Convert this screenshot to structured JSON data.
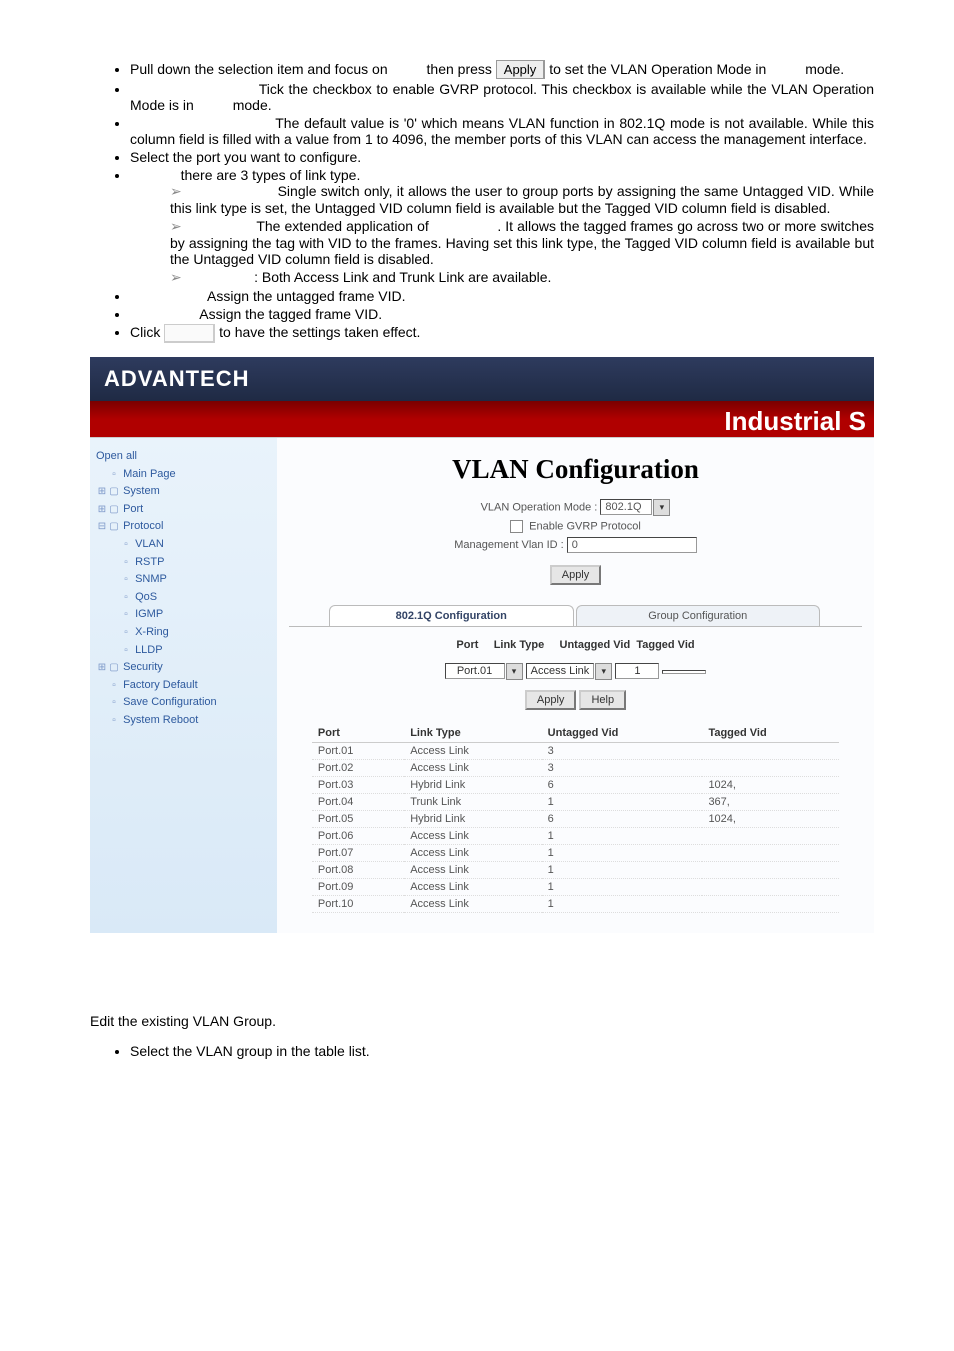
{
  "intro": {
    "li1a": "Pull down the selection item and focus on ",
    "apply_txt": "Apply",
    "li1b": " then press ",
    "li1c": " to set the VLAN Operation Mode in ",
    "li1d": " mode.",
    "li2a": "Tick the checkbox to enable GVRP protocol. This checkbox is available while the VLAN Operation Mode is in ",
    "li2b": " mode.",
    "li3": "The default value is '0' which means VLAN function in 802.1Q mode is not available. While this column field is filled with a value from 1 to 4096, the member ports of this VLAN can access the management interface.",
    "li4": "Select the port you want to configure.",
    "li5": " there are 3 types of link type.",
    "ar1": "Single switch only, it allows the user to group ports by assigning the same Untagged VID. While this link type is set, the Untagged VID column field is available but the Tagged VID column field is disabled.",
    "ar2a": "The extended application of ",
    "ar2b": ". It allows the tagged frames go across two or more switches by assigning the tag with VID to the frames. Having set this link type, the Tagged VID column field is available but the Untagged VID column field is disabled.",
    "ar3": ": Both Access Link and Trunk Link are available.",
    "li6": "Assign the untagged frame VID.",
    "li7": "Assign the tagged frame VID.",
    "li8a": "Click ",
    "li8b": " to have the settings taken effect."
  },
  "screenshot": {
    "brand": "ADVANTECH",
    "banner": "Industrial S",
    "nav": {
      "open": "Open all",
      "main": "Main Page",
      "system": "System",
      "port": "Port",
      "protocol": "Protocol",
      "vlan": "VLAN",
      "rstp": "RSTP",
      "snmp": "SNMP",
      "qos": "QoS",
      "igmp": "IGMP",
      "xring": "X-Ring",
      "lldp": "LLDP",
      "security": "Security",
      "fdefault": "Factory Default",
      "savecfg": "Save Configuration",
      "sysreboot": "System Reboot"
    },
    "main_title": "VLAN Configuration",
    "mode_label": "VLAN Operation Mode :",
    "mode_value": "802.1Q",
    "gvrp": "Enable GVRP Protocol",
    "mgmt_label": "Management Vlan ID :",
    "mgmt_value": "0",
    "apply": "Apply",
    "tab1": "802.1Q Configuration",
    "tab2": "Group Configuration",
    "hdr_port": "Port",
    "hdr_link": "Link Type",
    "hdr_unt": "Untagged Vid",
    "hdr_tag": "Tagged Vid",
    "sel_port": "Port.01",
    "sel_link": "Access Link",
    "sel_unt": "1",
    "help": "Help",
    "table": [
      {
        "p": "Port.01",
        "l": "Access Link",
        "u": "3",
        "t": ""
      },
      {
        "p": "Port.02",
        "l": "Access Link",
        "u": "3",
        "t": ""
      },
      {
        "p": "Port.03",
        "l": "Hybrid Link",
        "u": "6",
        "t": "1024,"
      },
      {
        "p": "Port.04",
        "l": "Trunk Link",
        "u": "1",
        "t": "367,"
      },
      {
        "p": "Port.05",
        "l": "Hybrid Link",
        "u": "6",
        "t": "1024,"
      },
      {
        "p": "Port.06",
        "l": "Access Link",
        "u": "1",
        "t": ""
      },
      {
        "p": "Port.07",
        "l": "Access Link",
        "u": "1",
        "t": ""
      },
      {
        "p": "Port.08",
        "l": "Access Link",
        "u": "1",
        "t": ""
      },
      {
        "p": "Port.09",
        "l": "Access Link",
        "u": "1",
        "t": ""
      },
      {
        "p": "Port.10",
        "l": "Access Link",
        "u": "1",
        "t": ""
      }
    ]
  },
  "footer": {
    "p1": "Edit the existing VLAN Group.",
    "li1": "Select the VLAN group in the table list."
  }
}
